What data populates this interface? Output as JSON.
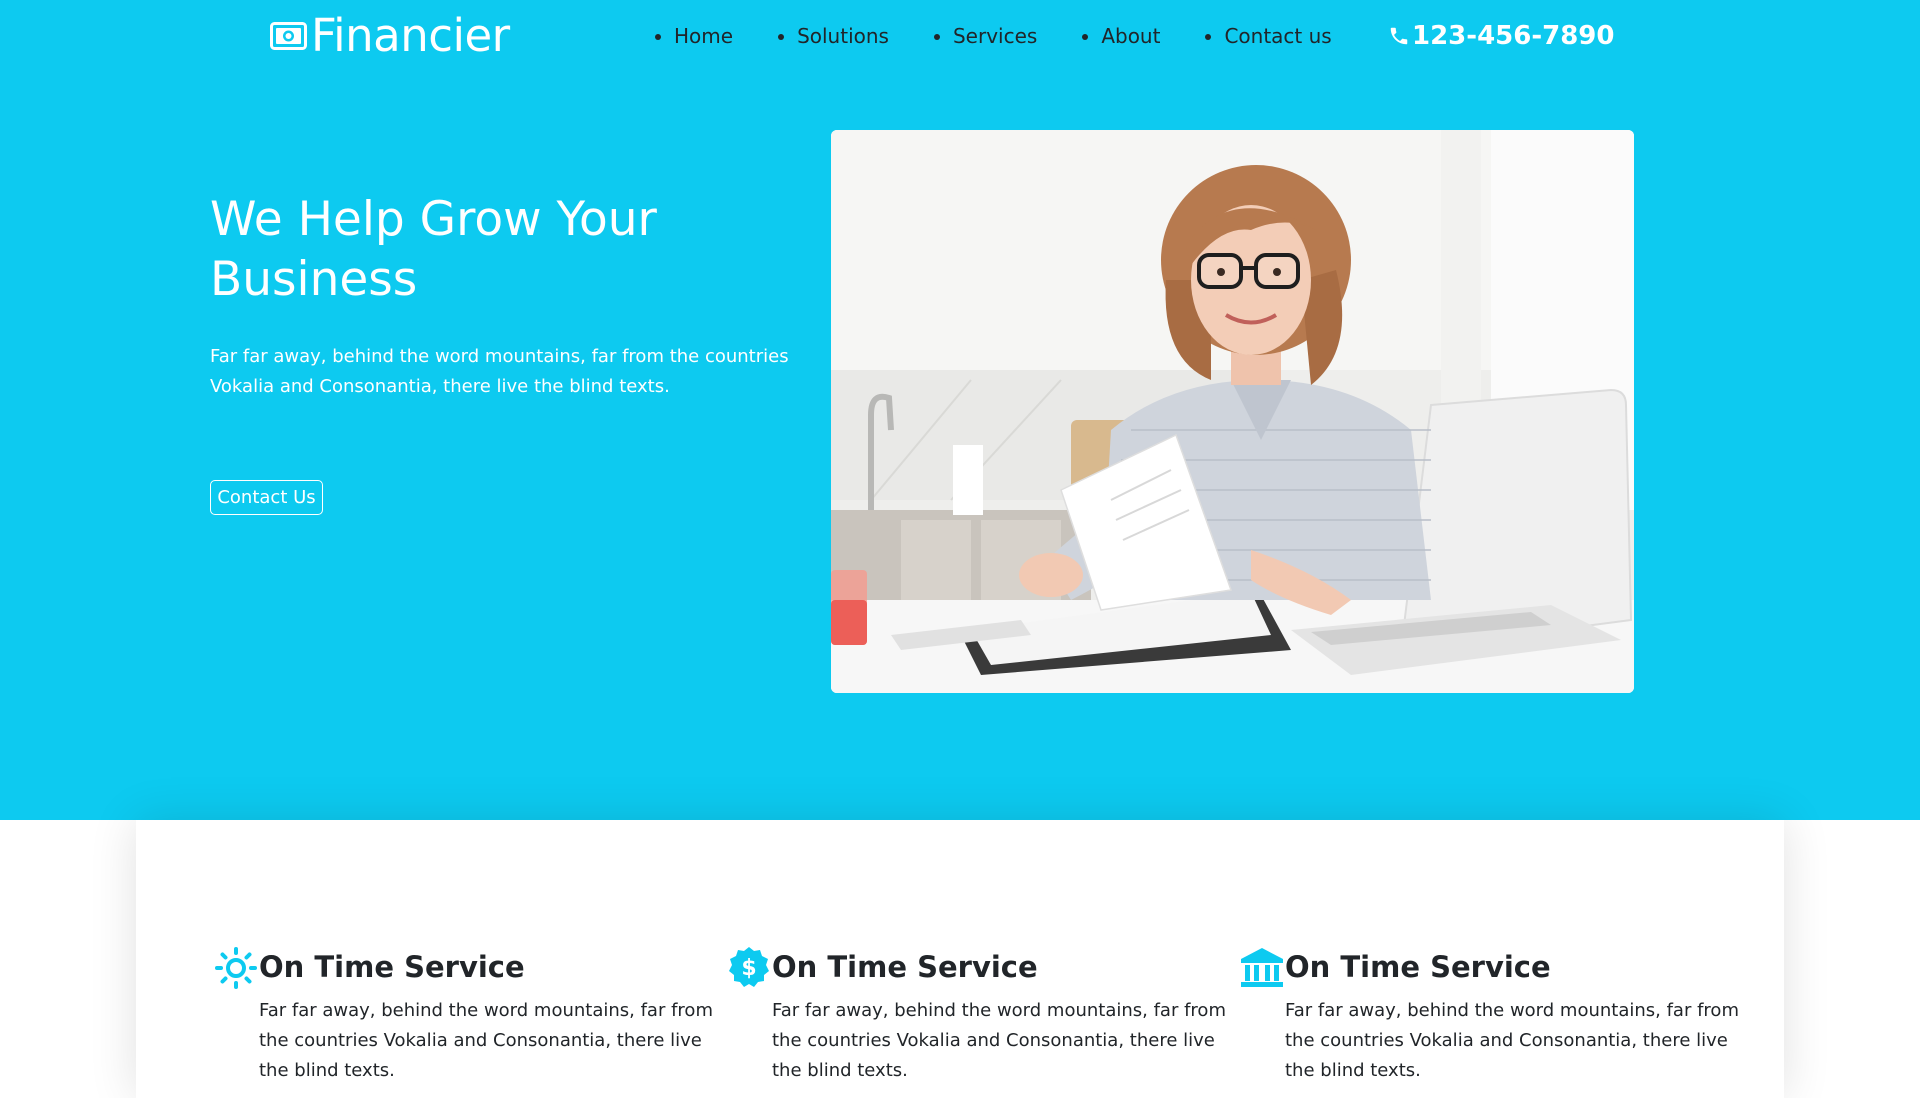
{
  "brand": {
    "name": "Financier",
    "icon": "money-bill-icon"
  },
  "nav": {
    "items": [
      {
        "label": "Home"
      },
      {
        "label": "Solutions"
      },
      {
        "label": "Services"
      },
      {
        "label": "About"
      },
      {
        "label": "Contact us"
      }
    ]
  },
  "phone": {
    "number": "123-456-7890",
    "icon": "phone-icon"
  },
  "hero": {
    "title": "We Help Grow Your Business",
    "text": "Far far away, behind the word mountains, far from the countries Vokalia and Consonantia, there live the blind texts.",
    "button_label": "Contact Us",
    "image": "woman-with-glasses-reviewing-documents-at-laptop",
    "background_color": "#0dcaf0"
  },
  "features": [
    {
      "icon": "sun-gear-icon",
      "title": "On Time Service",
      "text": "Far far away, behind the word mountains, far from the countries Vokalia and Consonantia, there live the blind texts."
    },
    {
      "icon": "dollar-badge-icon",
      "title": "On Time Service",
      "text": "Far far away, behind the word mountains, far from the countries Vokalia and Consonantia, there live the blind texts."
    },
    {
      "icon": "bank-icon",
      "title": "On Time Service",
      "text": "Far far away, behind the word mountains, far from the countries Vokalia and Consonantia, there live the blind texts."
    }
  ],
  "colors": {
    "accent": "#0dcaf0",
    "text": "#212529",
    "white": "#ffffff"
  }
}
